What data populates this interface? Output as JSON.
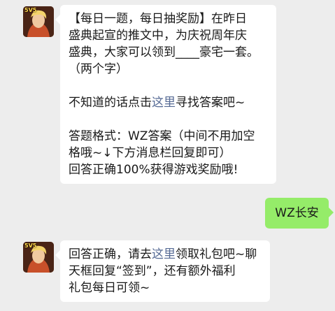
{
  "colors": {
    "background": "#ededed",
    "bubble_in": "#ffffff",
    "bubble_out": "#95ec69",
    "link": "#576b95"
  },
  "messages": [
    {
      "sender": "avatar-game-hero",
      "badge": "5V5",
      "lines": [
        "【每日一题，每日抽奖励】在昨日",
        "盛典起宣的推文中，为庆祝周年庆",
        "盛典，大家可以领到____豪宅一套。",
        "（两个字）"
      ],
      "hint_prefix": "不知道的话点击",
      "hint_link": "这里",
      "hint_suffix": "寻找答案吧~",
      "format_lines": [
        "答题格式：WZ答案（中间不用加空",
        "格哦~↓下方消息栏回复即可）",
        "回答正确100%获得游戏奖励哦!"
      ]
    },
    {
      "sender": "me",
      "text": "WZ长安"
    },
    {
      "sender": "avatar-game-hero",
      "badge": "5V5",
      "prefix": "回答正确，请去",
      "link": "这里",
      "suffix": "领取礼包吧~聊",
      "lines": [
        "天框回复“签到”，还有额外福利",
        "礼包每日可领~"
      ]
    }
  ]
}
